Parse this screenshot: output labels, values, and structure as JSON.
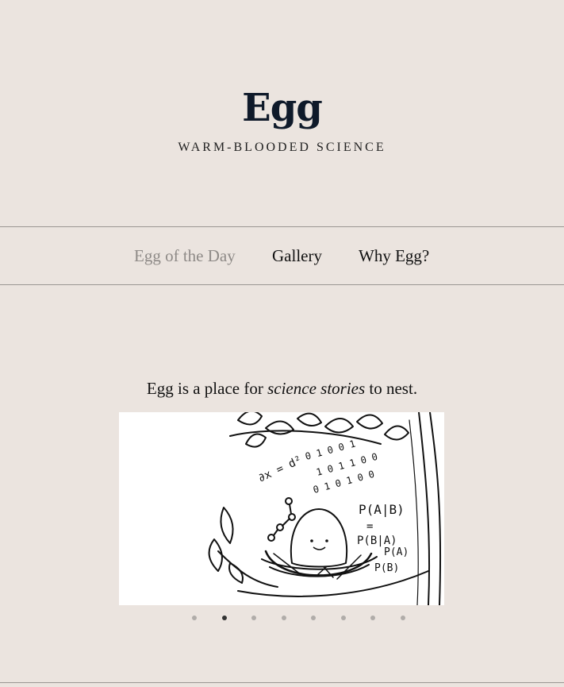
{
  "site": {
    "title": "Egg",
    "tagline": "WARM-BLOODED SCIENCE"
  },
  "nav": {
    "items": [
      {
        "label": "Egg of the Day",
        "active": true
      },
      {
        "label": "Gallery",
        "active": false
      },
      {
        "label": "Why Egg?",
        "active": false
      }
    ]
  },
  "intro": {
    "before": "Egg is a place for ",
    "emphasis": "science stories",
    "after": " to nest."
  },
  "carousel": {
    "slide_count": 8,
    "active_index": 1,
    "slide_text": {
      "formula_top": "P(A|B)",
      "formula_eq": "=",
      "formula_bottom": "P(B|A)",
      "formula_a": "P(A)",
      "formula_b": "P(B)",
      "binary_1": "0 1 0 0 1",
      "binary_2": "1 0 1 1 0 0",
      "binary_3": "0 1 0 1 0 0",
      "math": "∂x = d²"
    }
  },
  "colors": {
    "background": "#ebe4df",
    "title": "#0f1a2a",
    "nav_active": "#8e8a87",
    "divider": "#9a9692"
  }
}
